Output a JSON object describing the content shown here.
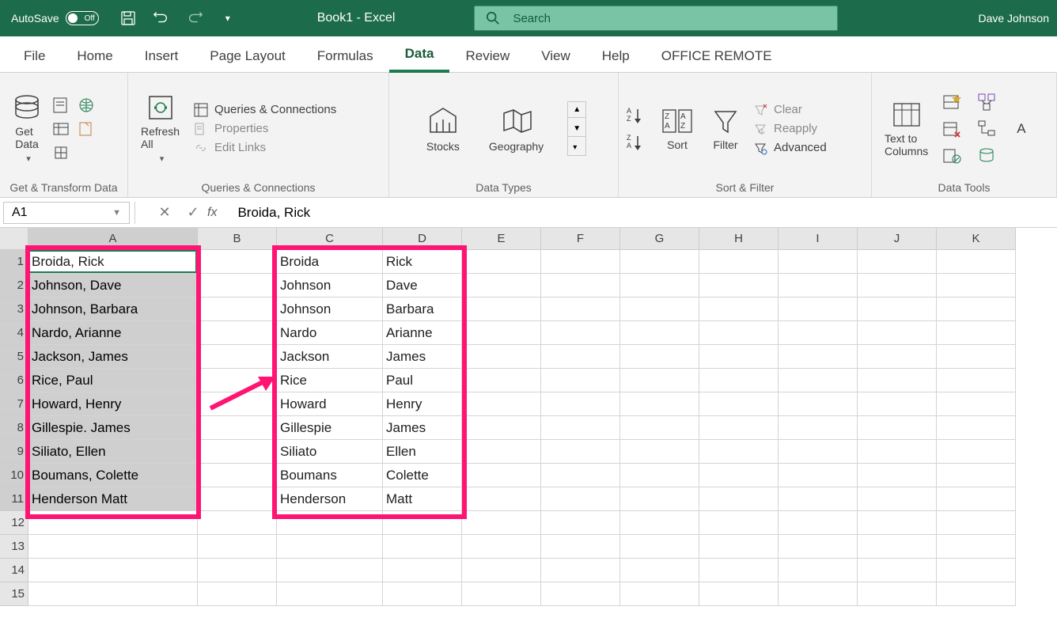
{
  "titlebar": {
    "autosave": "AutoSave",
    "toggle": "Off",
    "book": "Book1  -  Excel",
    "search": "Search",
    "user": "Dave Johnson"
  },
  "tabs": [
    "File",
    "Home",
    "Insert",
    "Page Layout",
    "Formulas",
    "Data",
    "Review",
    "View",
    "Help",
    "OFFICE REMOTE"
  ],
  "active_tab": "Data",
  "ribbon": {
    "group1": {
      "label": "Get & Transform Data",
      "getdata": "Get\nData"
    },
    "group2": {
      "label": "Queries & Connections",
      "refresh": "Refresh\nAll",
      "qc": "Queries & Connections",
      "props": "Properties",
      "edit": "Edit Links"
    },
    "group3": {
      "label": "Data Types",
      "stocks": "Stocks",
      "geo": "Geography"
    },
    "group4": {
      "label": "Sort & Filter",
      "sort": "Sort",
      "filter": "Filter",
      "clear": "Clear",
      "reapply": "Reapply",
      "adv": "Advanced"
    },
    "group5": {
      "label": "Data Tools",
      "ttc": "Text to\nColumns"
    }
  },
  "namebox": "A1",
  "formula": "Broida, Rick",
  "columns": [
    "A",
    "B",
    "C",
    "D",
    "E",
    "F",
    "G",
    "H",
    "I",
    "J",
    "K"
  ],
  "col_widths": {
    "A": 214,
    "default": 100
  },
  "rows": [
    1,
    2,
    3,
    4,
    5,
    6,
    7,
    8,
    9,
    10,
    11,
    12,
    13,
    14,
    15
  ],
  "data_A": [
    "Broida, Rick",
    "Johnson, Dave",
    "Johnson, Barbara",
    "Nardo, Arianne",
    "Jackson, James",
    "Rice, Paul",
    "Howard, Henry",
    "Gillespie. James",
    "Siliato, Ellen",
    "Boumans, Colette",
    "Henderson Matt"
  ],
  "data_C": [
    "Broida",
    "Johnson",
    "Johnson",
    "Nardo",
    "Jackson",
    "Rice",
    "Howard",
    "Gillespie",
    "Siliato",
    "Boumans",
    "Henderson"
  ],
  "data_D": [
    "Rick",
    "Dave",
    "Barbara",
    "Arianne",
    "James",
    "Paul",
    "Henry",
    "James",
    "Ellen",
    "Colette",
    "Matt"
  ],
  "highlight_color": "#ff1473"
}
